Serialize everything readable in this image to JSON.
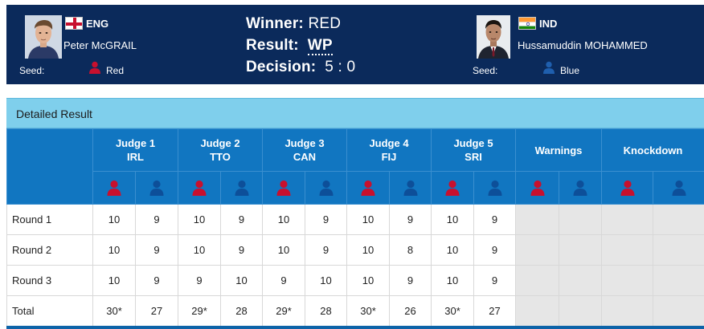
{
  "colors": {
    "header_bg": "#0b2a5b",
    "table_head_bg": "#1176c1",
    "section_head_bg": "#7fcfec",
    "red_corner": "#c8102e",
    "blue_corner": "#0f4c97",
    "empty_cell": "#e6e6e6"
  },
  "red_athlete": {
    "country": "ENG",
    "name": "Peter McGRAIL",
    "seed_label": "Seed:",
    "corner": "Red",
    "flag_icon": "england-flag-icon"
  },
  "blue_athlete": {
    "country": "IND",
    "name": "Hussamuddin MOHAMMED",
    "seed_label": "Seed:",
    "corner": "Blue",
    "flag_icon": "india-flag-icon"
  },
  "bout": {
    "winner_label": "Winner:",
    "winner_value": "RED",
    "result_label": "Result:",
    "result_value": "WP",
    "decision_label": "Decision:",
    "decision_value": "5 : 0"
  },
  "detail": {
    "title": "Detailed Result",
    "judges": [
      {
        "name": "Judge 1",
        "country": "IRL"
      },
      {
        "name": "Judge 2",
        "country": "TTO"
      },
      {
        "name": "Judge 3",
        "country": "CAN"
      },
      {
        "name": "Judge 4",
        "country": "FIJ"
      },
      {
        "name": "Judge 5",
        "country": "SRI"
      }
    ],
    "warnings_label": "Warnings",
    "knockdown_label": "Knockdown",
    "rows": [
      {
        "label": "Round 1",
        "scores": [
          "10",
          "9",
          "10",
          "9",
          "10",
          "9",
          "10",
          "9",
          "10",
          "9"
        ]
      },
      {
        "label": "Round 2",
        "scores": [
          "10",
          "9",
          "10",
          "9",
          "10",
          "9",
          "10",
          "8",
          "10",
          "9"
        ]
      },
      {
        "label": "Round 3",
        "scores": [
          "10",
          "9",
          "9",
          "10",
          "9",
          "10",
          "10",
          "9",
          "10",
          "9"
        ]
      },
      {
        "label": "Total",
        "scores": [
          "30*",
          "27",
          "29*",
          "28",
          "29*",
          "28",
          "30*",
          "26",
          "30*",
          "27"
        ]
      }
    ]
  }
}
